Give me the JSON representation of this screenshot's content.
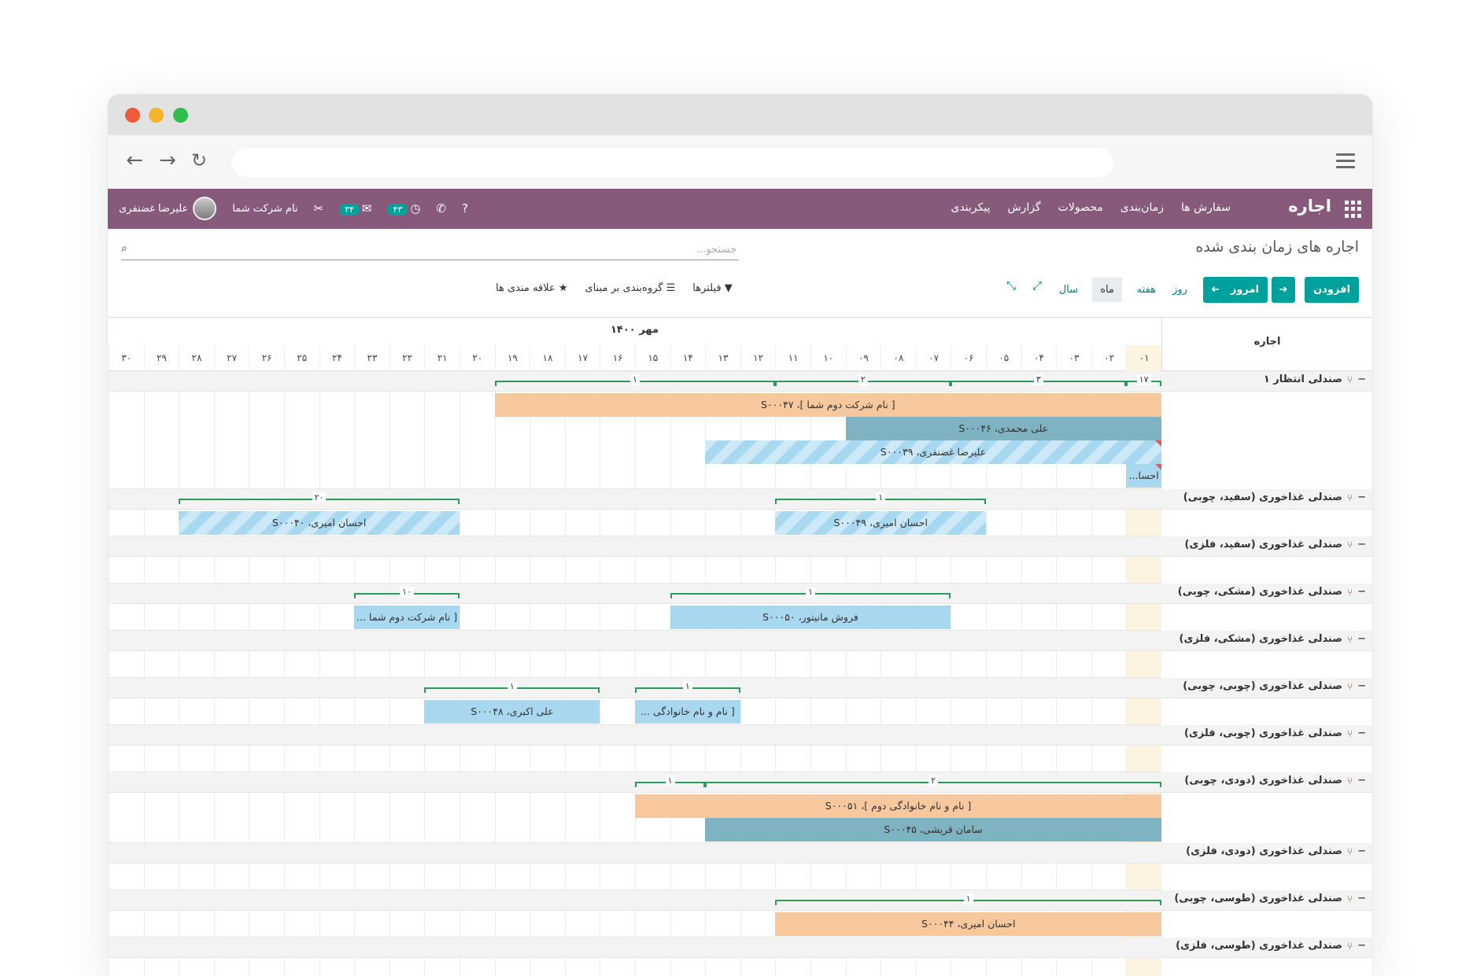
{
  "browser": {
    "url": ""
  },
  "appbar": {
    "brand": "اجاره",
    "menu": [
      "سفارش ها",
      "زمان‌بندی",
      "محصولات",
      "گزارش",
      "پیکربندی"
    ],
    "user_name": "علیرضا غضنفری",
    "company": "نام شرکت شما",
    "messages_count": "۳۴",
    "activities_count": "۴۳"
  },
  "control": {
    "breadcrumb": "اجاره های زمان بندی شده",
    "search_placeholder": "جستجو...",
    "add_label": "افزودن",
    "today_label": "امروز",
    "scales": [
      "روز",
      "هفته",
      "ماه",
      "سال"
    ],
    "active_scale": "ماه",
    "filters_label": "فیلترها",
    "groupby_label": "گروه‌بندی بر مبنای",
    "favorites_label": "علاقه مندی ها"
  },
  "gantt": {
    "header_label": "اجاره",
    "month_title": "مهر ۱۴۰۰",
    "days": [
      "۰۱",
      "۰۲",
      "۰۳",
      "۰۴",
      "۰۵",
      "۰۶",
      "۰۷",
      "۰۸",
      "۰۹",
      "۱۰",
      "۱۱",
      "۱۲",
      "۱۳",
      "۱۴",
      "۱۵",
      "۱۶",
      "۱۷",
      "۱۸",
      "۱۹",
      "۲۰",
      "۲۱",
      "۲۲",
      "۲۳",
      "۲۴",
      "۲۵",
      "۲۶",
      "۲۷",
      "۲۸",
      "۲۹",
      "۳۰"
    ],
    "rows": [
      {
        "label": "صندلی انتظار ۱",
        "lanes": 4,
        "aggregates": [
          {
            "from": 1,
            "to": 1,
            "count": "۱۷"
          },
          {
            "from": 2,
            "to": 6,
            "count": "۳"
          },
          {
            "from": 7,
            "to": 11,
            "count": "۲"
          },
          {
            "from": 12,
            "to": 19,
            "count": "۱"
          }
        ],
        "pills": [
          {
            "from": 1,
            "to": 19,
            "lane": 0,
            "color": "orange",
            "label": "[ نام شرکت دوم شما ]، S۰۰۰۴۷"
          },
          {
            "from": 1,
            "to": 9,
            "lane": 1,
            "color": "teal",
            "label": "علی محمدی، S۰۰۰۴۶"
          },
          {
            "from": 1,
            "to": 13,
            "lane": 2,
            "color": "striped",
            "label": "علیرضا غضنفری، S۰۰۰۳۹",
            "flag": true
          },
          {
            "from": 1,
            "to": 1,
            "lane": 3,
            "color": "blue",
            "label": "احسا...",
            "flag": true
          }
        ]
      },
      {
        "label": "صندلی غذاخوری (سفید، چوبی)",
        "lanes": 1,
        "aggregates": [
          {
            "from": 6,
            "to": 11,
            "count": "۱"
          },
          {
            "from": 21,
            "to": 28,
            "count": "۲۰"
          }
        ],
        "pills": [
          {
            "from": 6,
            "to": 11,
            "lane": 0,
            "color": "striped",
            "label": "احسان امیری، S۰۰۰۴۹"
          },
          {
            "from": 21,
            "to": 28,
            "lane": 0,
            "color": "striped",
            "label": "احسان امیری، S۰۰۰۴۰"
          }
        ]
      },
      {
        "label": "صندلی غذاخوری (سفید، فلزی)",
        "lanes": 1,
        "aggregates": [],
        "pills": []
      },
      {
        "label": "صندلی غذاخوری (مشکی، چوبی)",
        "lanes": 1,
        "aggregates": [
          {
            "from": 7,
            "to": 14,
            "count": "۱"
          },
          {
            "from": 21,
            "to": 23,
            "count": "۱۰"
          }
        ],
        "pills": [
          {
            "from": 7,
            "to": 14,
            "lane": 0,
            "color": "blue",
            "label": "فروش مانیتور، S۰۰۰۵۰"
          },
          {
            "from": 21,
            "to": 23,
            "lane": 0,
            "color": "blue",
            "label": "[ نام شرکت دوم شما ..."
          }
        ]
      },
      {
        "label": "صندلی غذاخوری (مشکی، فلزی)",
        "lanes": 1,
        "aggregates": [],
        "pills": []
      },
      {
        "label": "صندلی غذاخوری (چوبی، چوبی)",
        "lanes": 1,
        "aggregates": [
          {
            "from": 13,
            "to": 15,
            "count": "۱"
          },
          {
            "from": 17,
            "to": 21,
            "count": "۱"
          }
        ],
        "pills": [
          {
            "from": 13,
            "to": 15,
            "lane": 0,
            "color": "blue",
            "label": "[ نام و نام خانوادگی ..."
          },
          {
            "from": 17,
            "to": 21,
            "lane": 0,
            "color": "blue",
            "label": "علی اکبری، S۰۰۰۴۸"
          }
        ]
      },
      {
        "label": "صندلی غذاخوری (چوبی، فلزی)",
        "lanes": 1,
        "aggregates": [],
        "pills": []
      },
      {
        "label": "صندلی غذاخوری (دودی، چوبی)",
        "lanes": 2,
        "aggregates": [
          {
            "from": 1,
            "to": 13,
            "count": "۲"
          },
          {
            "from": 14,
            "to": 15,
            "count": "۱"
          }
        ],
        "pills": [
          {
            "from": 1,
            "to": 15,
            "lane": 0,
            "color": "orange",
            "label": "[ نام و نام خانوادگی دوم ]، S۰۰۰۵۱"
          },
          {
            "from": 1,
            "to": 13,
            "lane": 1,
            "color": "teal",
            "label": "سامان قریشی، S۰۰۰۴۵"
          }
        ]
      },
      {
        "label": "صندلی غذاخوری (دودی، فلزی)",
        "lanes": 1,
        "aggregates": [],
        "pills": []
      },
      {
        "label": "صندلی غذاخوری (طوسی، چوبی)",
        "lanes": 1,
        "aggregates": [
          {
            "from": 1,
            "to": 11,
            "count": "۱"
          }
        ],
        "pills": [
          {
            "from": 1,
            "to": 11,
            "lane": 0,
            "color": "orange",
            "label": "احسان امیری، S۰۰۰۴۴"
          }
        ]
      },
      {
        "label": "صندلی غذاخوری (طوسی، فلزی)",
        "lanes": 1,
        "aggregates": [],
        "pills": []
      }
    ]
  }
}
